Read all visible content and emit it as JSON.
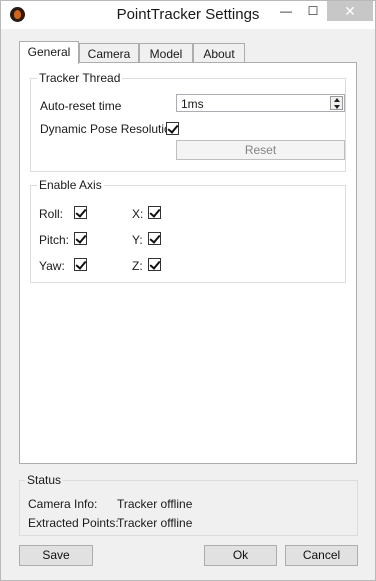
{
  "window": {
    "title": "PointTracker Settings",
    "controls": {
      "minimize": "—",
      "maximize": "☐",
      "close": "✕"
    }
  },
  "tabs": [
    {
      "label": "General",
      "active": true
    },
    {
      "label": "Camera",
      "active": false
    },
    {
      "label": "Model",
      "active": false
    },
    {
      "label": "About",
      "active": false
    }
  ],
  "tracker_thread": {
    "title": "Tracker Thread",
    "auto_reset_label": "Auto-reset time",
    "auto_reset_value": "1ms",
    "dynamic_pose_label": "Dynamic Pose Resolution",
    "dynamic_pose_checked": true,
    "reset_label": "Reset",
    "reset_enabled": false
  },
  "enable_axis": {
    "title": "Enable Axis",
    "items": [
      {
        "label": "Roll:",
        "checked": true
      },
      {
        "label": "X:",
        "checked": true
      },
      {
        "label": "Pitch:",
        "checked": true
      },
      {
        "label": "Y:",
        "checked": true
      },
      {
        "label": "Yaw:",
        "checked": true
      },
      {
        "label": "Z:",
        "checked": true
      }
    ]
  },
  "status": {
    "title": "Status",
    "camera_info_label": "Camera Info:",
    "camera_info_value": "Tracker offline",
    "extracted_points_label": "Extracted Points:",
    "extracted_points_value": "Tracker offline"
  },
  "buttons": {
    "save": "Save",
    "ok": "Ok",
    "cancel": "Cancel"
  },
  "icons": {
    "app": "pointtracker-app-icon",
    "checkbox_checked": "checkmark-icon"
  }
}
